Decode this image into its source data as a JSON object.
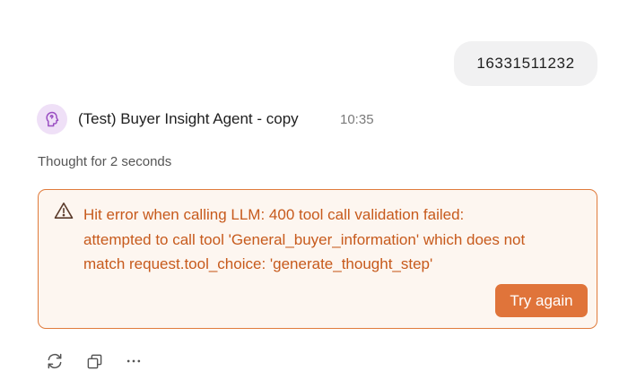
{
  "user_message": {
    "text": "16331511232"
  },
  "agent": {
    "name": "(Test) Buyer Insight Agent - copy",
    "time": "10:35",
    "avatar_icon": "brain-head-icon",
    "avatar_bg": "#efe0f7",
    "avatar_fg": "#9a4fc2"
  },
  "thought": {
    "label": "Thought for 2 seconds"
  },
  "error": {
    "icon": "warning-triangle-icon",
    "line1": "Hit error when calling LLM: 400 tool call validation failed:",
    "line2": "attempted to call tool 'General_buyer_information' which does not",
    "line3": "match request.tool_choice: 'generate_thought_step'",
    "retry_label": "Try again",
    "accent": "#e0743a",
    "text_color": "#c75a1c",
    "background": "#fdf6f0"
  },
  "actions": [
    {
      "name": "regenerate-icon"
    },
    {
      "name": "copy-icon"
    },
    {
      "name": "more-icon"
    }
  ]
}
